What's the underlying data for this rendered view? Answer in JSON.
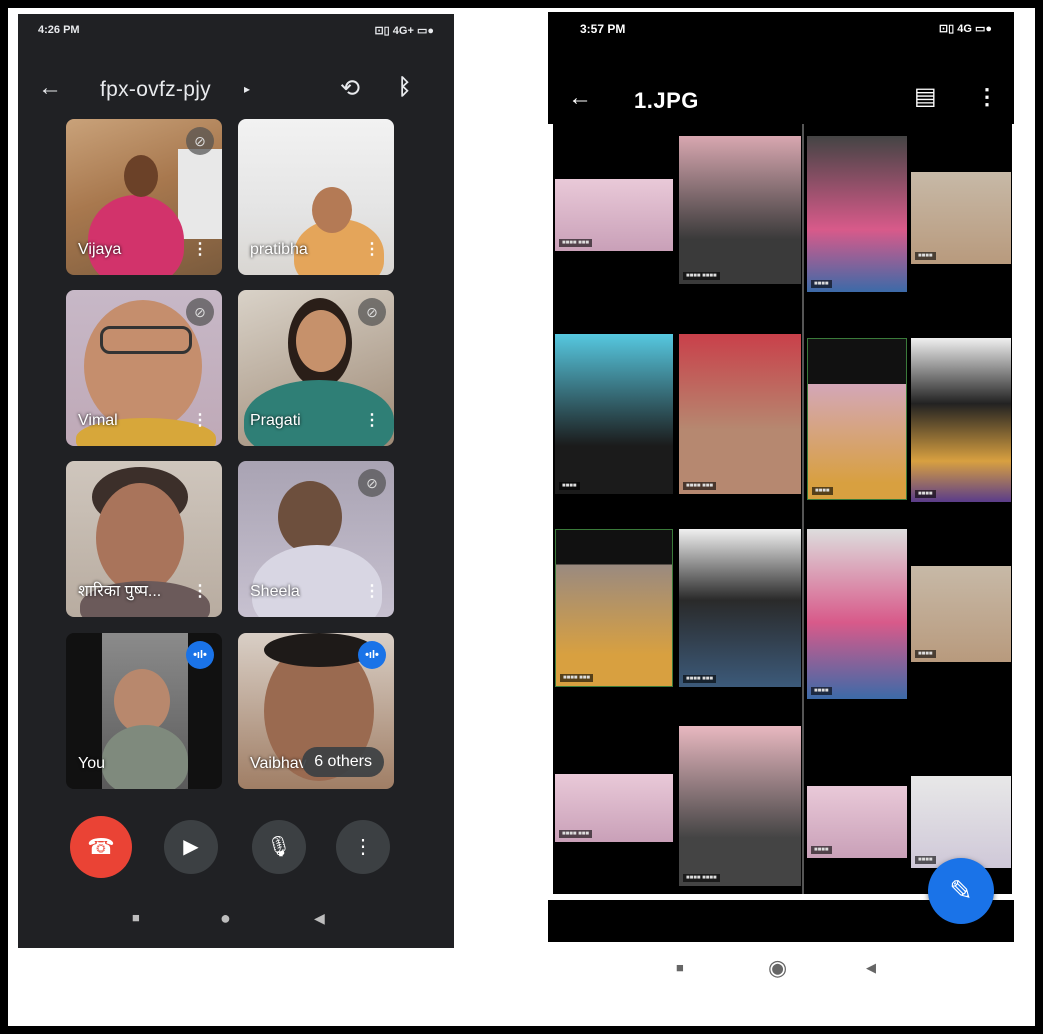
{
  "meet": {
    "status": {
      "time": "4:26 PM",
      "indicators": "⊡▯ 4G+ ▭●"
    },
    "header": {
      "back_icon": "←",
      "meeting_code": "fpx-ovfz-pjy",
      "caret_icon": "▸",
      "switch_camera_icon": "⟲",
      "bluetooth_icon": "ᛒ"
    },
    "participants": [
      {
        "name": "Vijaya",
        "muted": true
      },
      {
        "name": "pratibha",
        "muted": false
      },
      {
        "name": "Vimal",
        "muted": true
      },
      {
        "name": "Pragati",
        "muted": true
      },
      {
        "name": "शारिका पुष्प...",
        "muted": false
      },
      {
        "name": "Sheela",
        "muted": true
      },
      {
        "name": "You",
        "speaking": true
      },
      {
        "name": "Vaibhav",
        "speaking": true,
        "others_label": "6 others"
      }
    ],
    "controls": {
      "end_call_icon": "☎",
      "camera_icon": "▶",
      "mic_icon": "🎙",
      "more_icon": "⋮"
    },
    "navbar": {
      "recents": "■",
      "home": "●",
      "back": "◀"
    }
  },
  "viewer": {
    "status": {
      "time": "3:57 PM",
      "indicators": "⊡▯ 4G ▭●"
    },
    "header": {
      "back_icon": "←",
      "file_name": "1.JPG",
      "chat_icon": "▤",
      "more_icon": "⋮"
    },
    "fab": {
      "edit_icon": "✎"
    },
    "navbar": {
      "recents": "■",
      "home": "◉",
      "back": "◀"
    }
  },
  "colors": {
    "meet_bg": "#202124",
    "end_call": "#ea4335",
    "control_bg": "#3c4043",
    "accent_blue": "#1a73e8"
  }
}
